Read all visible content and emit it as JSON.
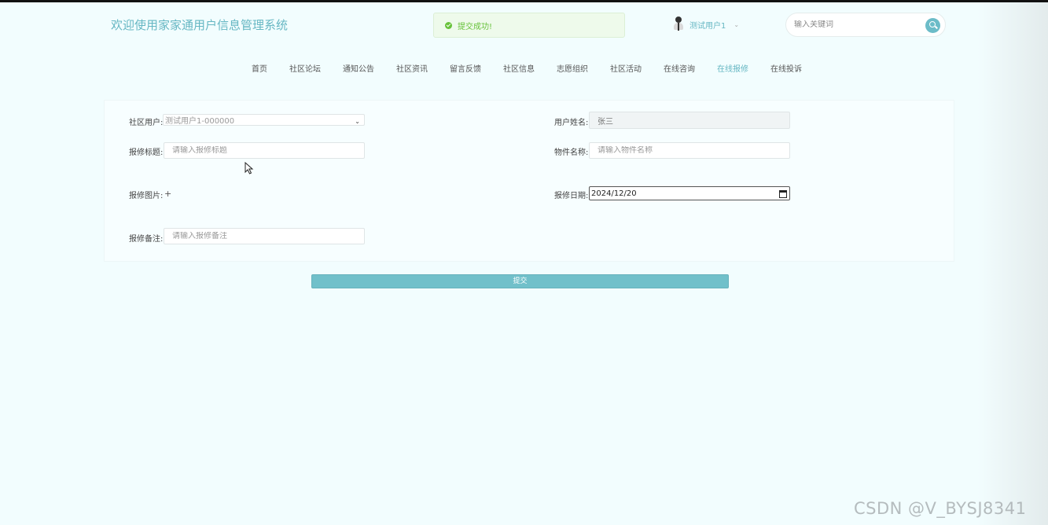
{
  "header": {
    "title": "欢迎使用家家通用户信息管理系统",
    "toast": "提交成功!",
    "user_name": "测试用户1",
    "user_caret": "⌄",
    "search_placeholder": "输入关键词"
  },
  "nav": {
    "items": [
      "首页",
      "社区论坛",
      "通知公告",
      "社区资讯",
      "留言反馈",
      "社区信息",
      "志愿组织",
      "社区活动",
      "在线咨询",
      "在线报修",
      "在线投诉"
    ],
    "active": "在线报修"
  },
  "form": {
    "community_user_label": "社区用户:",
    "community_user_value": "测试用户1-000000",
    "user_name_label": "用户姓名:",
    "user_name_value": "张三",
    "title_label": "报修标题:",
    "title_placeholder": "请输入报修标题",
    "item_name_label": "物件名称:",
    "item_name_placeholder": "请输入物件名称",
    "image_label": "报修图片:",
    "image_add": "+",
    "date_label": "报修日期:",
    "date_value": "2024/12/20",
    "remark_label": "报修备注:",
    "remark_placeholder": "请输入报修备注",
    "submit_label": "提交"
  },
  "watermark": "CSDN @V_BYSJ8341",
  "colors": {
    "accent": "#66b7c3",
    "button": "#71c0ca",
    "success": "#67c23a",
    "background": "#f2fdfe"
  },
  "icons": {
    "toast": "check-circle-icon",
    "avatar": "user-avatar-icon",
    "search": "search-icon",
    "date": "calendar-icon",
    "cursor": "mouse-pointer-icon"
  }
}
